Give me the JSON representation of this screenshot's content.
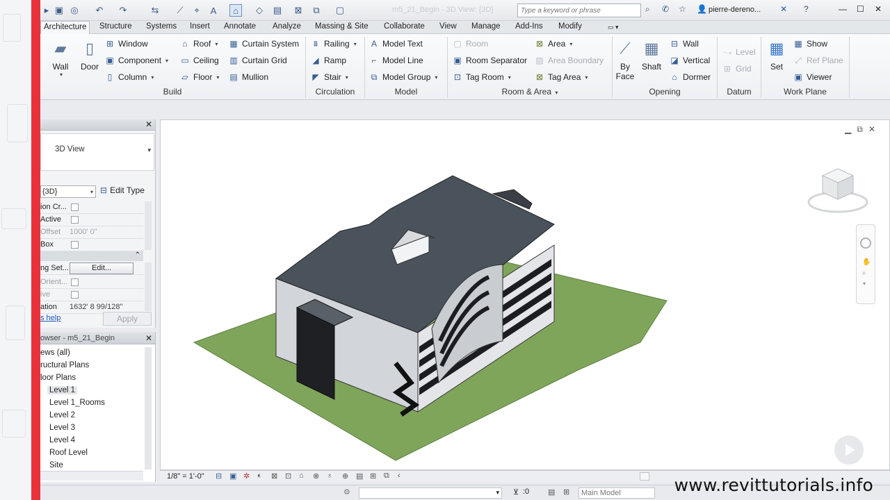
{
  "qat": {
    "doc_title": "m5_21_Begin - 3D View: {3D}",
    "search_placeholder": "Type a keyword or phrase",
    "user_name": "pierre-dereno..."
  },
  "tabs": [
    "Architecture",
    "Structure",
    "Systems",
    "Insert",
    "Annotate",
    "Analyze",
    "Massing & Site",
    "Collaborate",
    "View",
    "Manage",
    "Add-Ins",
    "Modify"
  ],
  "ribbon": {
    "build": {
      "label": "Build",
      "wall": "Wall",
      "door": "Door",
      "window": "Window",
      "component": "Component",
      "column": "Column",
      "roof": "Roof",
      "ceiling": "Ceiling",
      "floor": "Floor",
      "curtain_system": "Curtain System",
      "curtain_grid": "Curtain Grid",
      "mullion": "Mullion"
    },
    "circulation": {
      "label": "Circulation",
      "railing": "Railing",
      "ramp": "Ramp",
      "stair": "Stair"
    },
    "model": {
      "label": "Model",
      "model_text": "Model Text",
      "model_line": "Model Line",
      "model_group": "Model Group"
    },
    "room_area": {
      "label": "Room & Area",
      "room": "Room",
      "room_separator": "Room Separator",
      "tag_room": "Tag Room",
      "area": "Area",
      "area_boundary": "Area Boundary",
      "tag_area": "Tag Area"
    },
    "opening": {
      "label": "Opening",
      "by_face_1": "By",
      "by_face_2": "Face",
      "shaft": "Shaft",
      "wall": "Wall",
      "vertical": "Vertical",
      "dormer": "Dormer"
    },
    "datum": {
      "label": "Datum",
      "level": "Level",
      "grid": "Grid"
    },
    "work_plane": {
      "label": "Work Plane",
      "set": "Set",
      "show": "Show",
      "ref_plane": "Ref Plane",
      "viewer": "Viewer"
    }
  },
  "properties": {
    "type_name": "3D View",
    "view_select": "{3D}",
    "edit_type": "Edit Type",
    "rows": [
      {
        "label": "ion Cr...",
        "value": ""
      },
      {
        "label": "Active",
        "value": ""
      },
      {
        "label": "Offset",
        "value": "1000'  0\""
      },
      {
        "label": "Box",
        "value": ""
      }
    ],
    "rows2": [
      {
        "label": "ng Set...",
        "value": ""
      },
      {
        "label": "Orient...",
        "value": ""
      },
      {
        "label": "ive",
        "value": ""
      },
      {
        "label": "ation",
        "value": "1632'  8 99/128\""
      }
    ],
    "edit_button": "Edit...",
    "help": "s help",
    "apply": "Apply"
  },
  "browser": {
    "title": "owser - m5_21_Begin",
    "items": [
      "ews (all)",
      "ructural Plans",
      "loor Plans",
      "Level 1",
      "Level 1_Rooms",
      "Level 2",
      "Level 3",
      "Level 4",
      "Roof Level",
      "Site"
    ],
    "selected": "Level 1"
  },
  "view_control": {
    "scale": "1/8\" = 1'-0\""
  },
  "status": {
    "zero": ":0",
    "model": "Main Model"
  },
  "watermark": "www.revittutorials.info",
  "colors": {
    "accent_red": "#e8323a",
    "ground": "#7fa55a",
    "roof": "#4a525c",
    "wall": "#cfd2d6"
  }
}
